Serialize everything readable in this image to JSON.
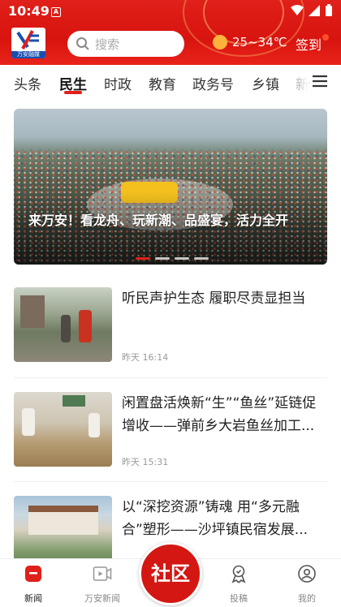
{
  "status_bar": {
    "time": "10:49",
    "app_badge": "A"
  },
  "header": {
    "logo_text": "万安融媒",
    "search_placeholder": "搜索",
    "weather": "25~34℃",
    "signin_label": "签到"
  },
  "tabs": [
    {
      "label": "头条",
      "active": false
    },
    {
      "label": "民生",
      "active": true
    },
    {
      "label": "时政",
      "active": false
    },
    {
      "label": "教育",
      "active": false
    },
    {
      "label": "政务号",
      "active": false
    },
    {
      "label": "乡镇",
      "active": false
    },
    {
      "label": "新",
      "active": false
    }
  ],
  "banner": {
    "title": "来万安！看龙舟、玩新潮、品盛宴，活力全开",
    "slide_count": 4,
    "active_slide": 1
  },
  "news": [
    {
      "title": "听民声护生态  履职尽责显担当",
      "time": "昨天 16:14"
    },
    {
      "title": "闲置盘活焕新“生”“鱼丝”延链促增收——弹前乡大岩鱼丝加工...",
      "time": "昨天 15:31"
    },
    {
      "title": "以“深挖资源”铸魂 用“多元融合”塑形——沙坪镇民宿发展...",
      "time": ""
    }
  ],
  "bottom_nav": {
    "news": "新闻",
    "wanan_news": "万安新闻",
    "community": "社区",
    "submit": "投稿",
    "mine": "我的"
  },
  "colors": {
    "brand_red": "#e0201a",
    "muted": "#888888"
  }
}
